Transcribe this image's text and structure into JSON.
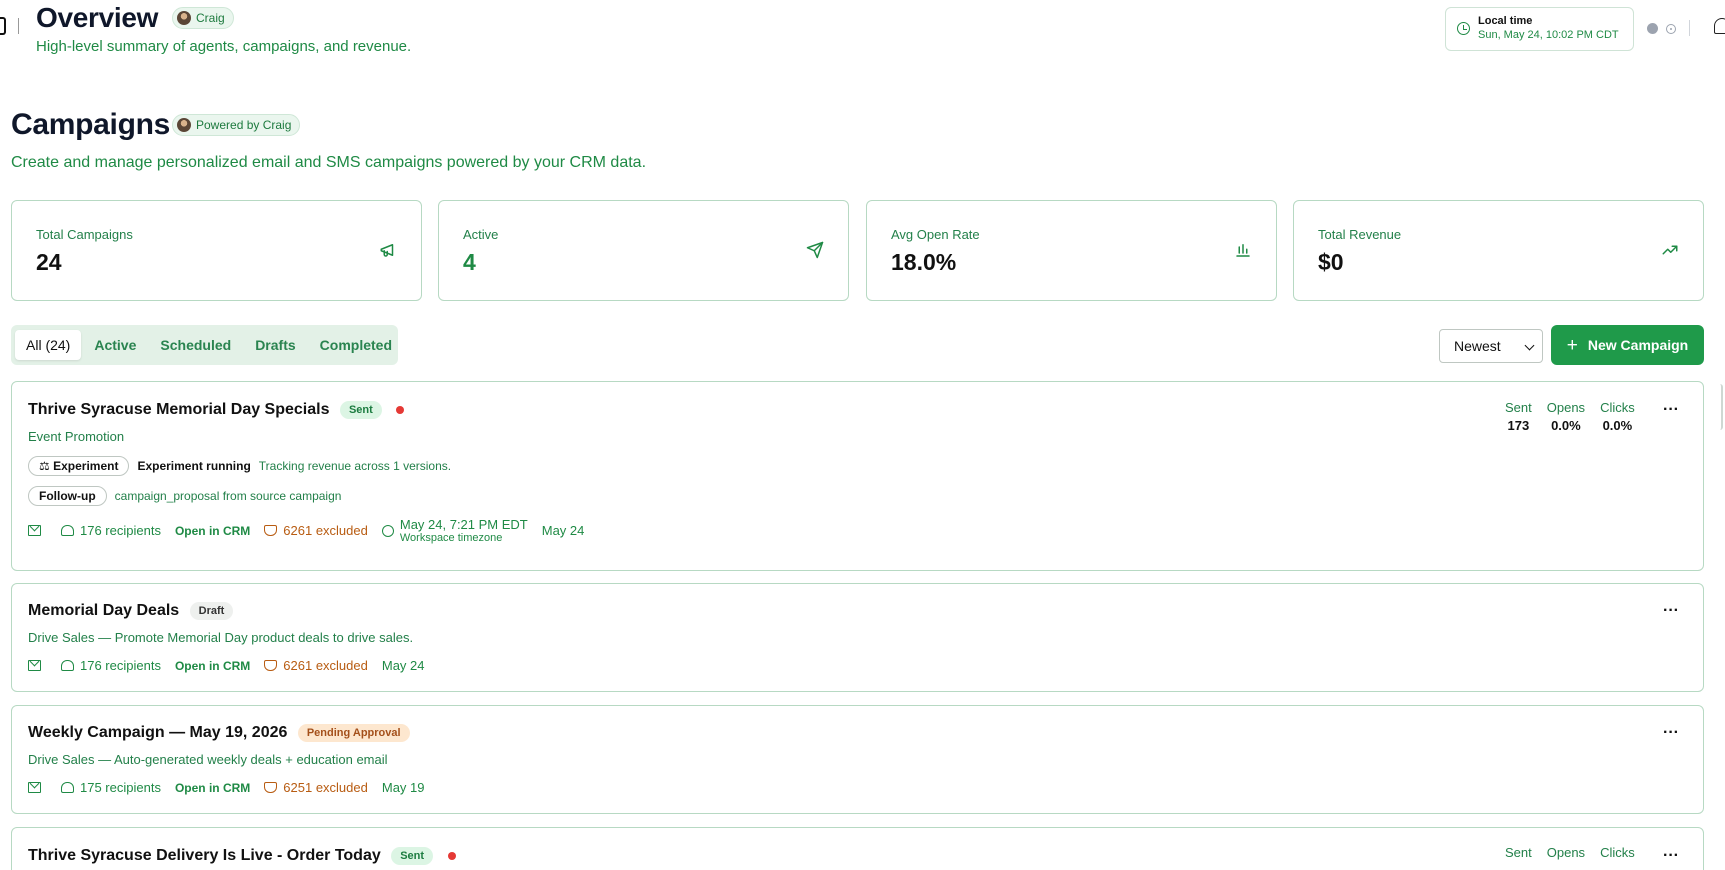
{
  "overview": {
    "title": "Overview",
    "badge": "Craig",
    "subtitle": "High-level summary of agents, campaigns, and revenue."
  },
  "local_time": {
    "label": "Local time",
    "value": "Sun, May 24, 10:02 PM CDT"
  },
  "campaigns": {
    "title": "Campaigns",
    "badge": "Powered by Craig",
    "subtitle": "Create and manage personalized email and SMS campaigns powered by your CRM data."
  },
  "stats": [
    {
      "label": "Total Campaigns",
      "value": "24",
      "icon": "megaphone-icon"
    },
    {
      "label": "Active",
      "value": "4",
      "icon": "send-icon"
    },
    {
      "label": "Avg Open Rate",
      "value": "18.0%",
      "icon": "bar-chart-icon"
    },
    {
      "label": "Total Revenue",
      "value": "$0",
      "icon": "trending-up-icon"
    }
  ],
  "tabs": [
    "All (24)",
    "Active",
    "Scheduled",
    "Drafts",
    "Completed"
  ],
  "sort": {
    "selected": "Newest"
  },
  "new_campaign_label": "New Campaign",
  "cards": [
    {
      "title": "Thrive Syracuse Memorial Day Specials",
      "status": "Sent",
      "subtitle": "Event Promotion",
      "experiment_chip": "Experiment",
      "experiment_label": "Experiment running",
      "experiment_note": "Tracking revenue across 1 versions.",
      "followup_chip": "Follow-up",
      "followup_note": "campaign_proposal from source campaign",
      "recipients": "176 recipients",
      "open_crm": "Open in CRM",
      "excluded": "6261 excluded",
      "schedule": "May 24, 7:21 PM EDT",
      "schedule_tz": "Workspace timezone",
      "date": "May 24",
      "metrics": {
        "sent_label": "Sent",
        "sent": "173",
        "opens_label": "Opens",
        "opens": "0.0%",
        "clicks_label": "Clicks",
        "clicks": "0.0%"
      },
      "more": "···"
    },
    {
      "title": "Memorial Day Deals",
      "status": "Draft",
      "subtitle": "Drive Sales — Promote Memorial Day product deals to drive sales.",
      "recipients": "176 recipients",
      "open_crm": "Open in CRM",
      "excluded": "6261 excluded",
      "date": "May 24",
      "more": "···"
    },
    {
      "title": "Weekly Campaign — May 19, 2026",
      "status": "Pending Approval",
      "subtitle": "Drive Sales — Auto-generated weekly deals + education email",
      "recipients": "175 recipients",
      "open_crm": "Open in CRM",
      "excluded": "6251 excluded",
      "date": "May 19",
      "more": "···"
    },
    {
      "title": "Thrive Syracuse Delivery Is Live - Order Today",
      "status": "Sent",
      "metrics": {
        "sent_label": "Sent",
        "opens_label": "Opens",
        "clicks_label": "Clicks"
      },
      "more": "···"
    }
  ]
}
